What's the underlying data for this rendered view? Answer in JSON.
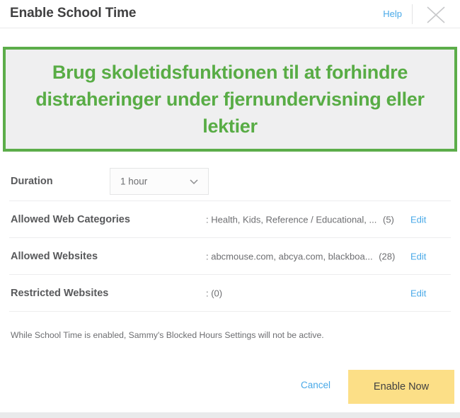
{
  "titlebar": {
    "title": "Enable School Time",
    "help_label": "Help",
    "close_icon": "close-icon"
  },
  "banner": {
    "text": "Brug skoletidsfunktionen til at forhindre distraheringer under fjernundervisning eller lektier",
    "border_color": "#5cad4a",
    "background_color": "#efeff0",
    "text_color": "#58ac45"
  },
  "rows": [
    {
      "label": "Duration",
      "control": "dropdown",
      "dropdown_value": "1 hour",
      "dropdown_icon": "chevron-down-icon"
    },
    {
      "label": "Allowed Web Categories",
      "value": ": Health, Kids, Reference / Educational, ...",
      "count": "(5)",
      "edit_label": "Edit"
    },
    {
      "label": "Allowed Websites",
      "value": ": abcmouse.com, abcya.com, blackboa...",
      "count": "(28)",
      "edit_label": "Edit"
    },
    {
      "label": "Restricted Websites",
      "value": ": (0)",
      "count": "",
      "edit_label": "Edit"
    }
  ],
  "note": "While School Time is enabled, Sammy's Blocked Hours Settings will not be active.",
  "footer": {
    "cancel_label": "Cancel",
    "enable_label": "Enable Now",
    "enable_color": "#fcdf87",
    "link_color": "#49a9e8"
  }
}
